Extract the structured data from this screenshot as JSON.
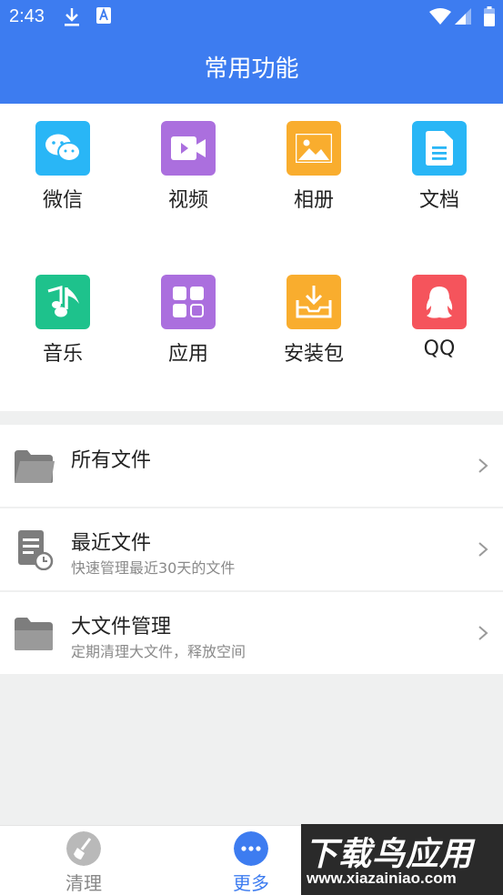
{
  "status": {
    "time": "2:43"
  },
  "header": {
    "title": "常用功能"
  },
  "grid": [
    {
      "label": "微信",
      "icon": "wechat-icon",
      "color": "#29b6f6"
    },
    {
      "label": "视频",
      "icon": "video-icon",
      "color": "#ab6fde"
    },
    {
      "label": "相册",
      "icon": "image-icon",
      "color": "#f9ad2e"
    },
    {
      "label": "文档",
      "icon": "document-icon",
      "color": "#29b6f6"
    },
    {
      "label": "音乐",
      "icon": "music-icon",
      "color": "#1ec28c"
    },
    {
      "label": "应用",
      "icon": "apps-icon",
      "color": "#ab6fde"
    },
    {
      "label": "安装包",
      "icon": "install-package-icon",
      "color": "#f9ad2e"
    },
    {
      "label": "QQ",
      "icon": "qq-icon",
      "color": "#f5545c"
    }
  ],
  "list": [
    {
      "title": "所有文件",
      "subtitle": "",
      "icon": "folder-icon"
    },
    {
      "title": "最近文件",
      "subtitle": "快速管理最近30天的文件",
      "icon": "recent-file-icon"
    },
    {
      "title": "大文件管理",
      "subtitle": "定期清理大文件，释放空间",
      "icon": "folder-icon"
    }
  ],
  "bottom_nav": [
    {
      "label": "清理",
      "icon": "broom-icon",
      "active": false
    },
    {
      "label": "更多",
      "icon": "more-icon",
      "active": true
    }
  ],
  "watermark": {
    "title": "下载鸟应用",
    "url": "www.xiazainiao.com"
  },
  "colors": {
    "primary": "#3d7cf0",
    "inactive": "#888888"
  }
}
